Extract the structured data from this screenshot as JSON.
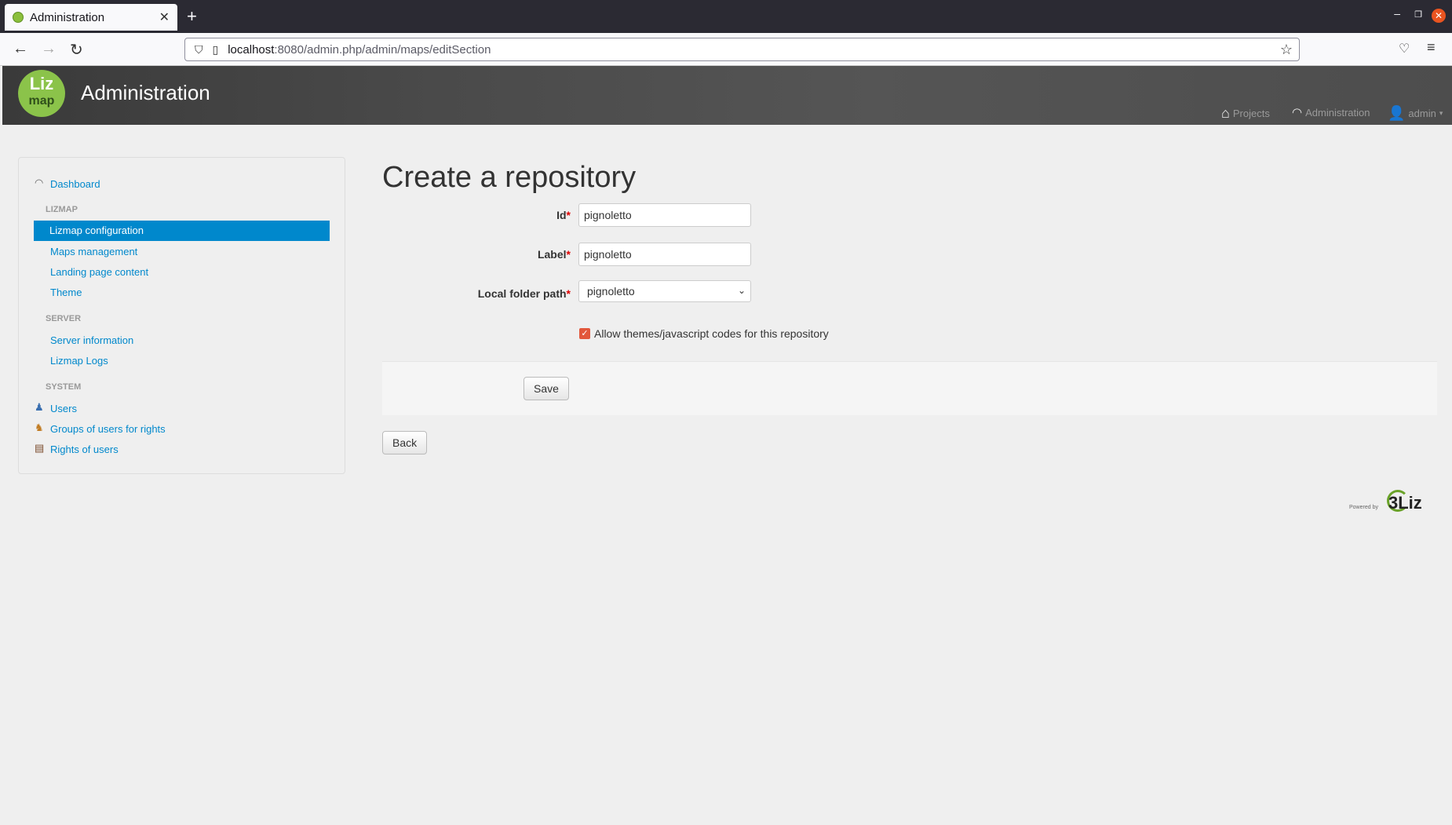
{
  "browser": {
    "tab_title": "Administration",
    "url_host": "localhost",
    "url_rest": ":8080/admin.php/admin/maps/editSection"
  },
  "header": {
    "logo_line1": "Liz",
    "logo_line2": "map",
    "title": "Administration",
    "nav": {
      "projects": "Projects",
      "administration": "Administration",
      "user": "admin"
    }
  },
  "sidebar": {
    "dashboard": "Dashboard",
    "lizmap_head": "LIZMAP",
    "lizmap_items": [
      "Lizmap configuration",
      "Maps management",
      "Landing page content",
      "Theme"
    ],
    "server_head": "SERVER",
    "server_items": [
      "Server information",
      "Lizmap Logs"
    ],
    "system_head": "SYSTEM",
    "system_items": [
      "Users",
      "Groups of users for rights",
      "Rights of users"
    ]
  },
  "main": {
    "title": "Create a repository",
    "form": {
      "id_label": "Id",
      "id_value": "pignoletto",
      "label_label": "Label",
      "label_value": "pignoletto",
      "path_label": "Local folder path",
      "path_value": "pignoletto",
      "required_mark": "*",
      "allow_themes_label": "Allow themes/javascript codes for this repository",
      "allow_themes_checked": true,
      "save_label": "Save"
    },
    "back_label": "Back"
  },
  "footer": {
    "powered_by": "Powered by",
    "brand": "3Liz"
  },
  "colors": {
    "accent": "#0088cc",
    "checkbox": "#e2573b",
    "logo": "#8bc34a"
  }
}
